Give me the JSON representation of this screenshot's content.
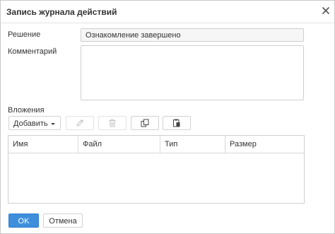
{
  "dialog": {
    "title": "Запись журнала действий"
  },
  "form": {
    "decision_label": "Решение",
    "decision_value": "Ознакомление завершено",
    "comment_label": "Комментарий",
    "comment_value": ""
  },
  "attachments": {
    "label": "Вложения",
    "toolbar": {
      "add_label": "Добавить",
      "icons": [
        "pencil-icon",
        "trash-icon",
        "copy-icon",
        "paste-icon"
      ]
    },
    "columns": [
      "Имя",
      "Файл",
      "Тип",
      "Размер"
    ],
    "rows": []
  },
  "footer": {
    "ok_label": "OK",
    "cancel_label": "Отмена"
  },
  "colors": {
    "primary_button": "#3d8fdb",
    "border": "#cfcfcf",
    "field_bg": "#f6f6f6"
  }
}
